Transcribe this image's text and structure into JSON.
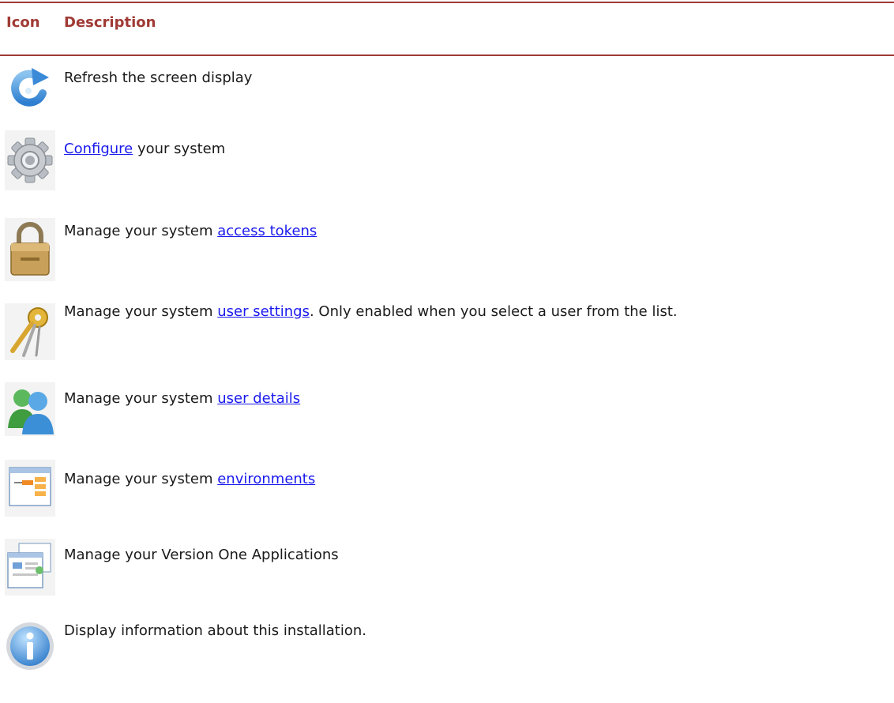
{
  "header": {
    "icon_label": "Icon",
    "description_label": "Description"
  },
  "rows": [
    {
      "icon": "refresh-icon",
      "before": "Refresh the screen display",
      "link": "",
      "after": ""
    },
    {
      "icon": "gear-icon",
      "before": "",
      "link": "Configure",
      "after": " your system"
    },
    {
      "icon": "lock-icon",
      "before": "Manage your system ",
      "link": "access tokens",
      "after": ""
    },
    {
      "icon": "keys-icon",
      "before": "Manage your system ",
      "link": "user settings",
      "after": ". Only enabled when you select a user from the list."
    },
    {
      "icon": "users-icon",
      "before": "Manage your system ",
      "link": "user details",
      "after": ""
    },
    {
      "icon": "environments-icon",
      "before": "Manage your system ",
      "link": "environments",
      "after": ""
    },
    {
      "icon": "applications-icon",
      "before": "Manage your Version One Applications",
      "link": "",
      "after": ""
    },
    {
      "icon": "info-icon",
      "before": "Display information about this installation.",
      "link": "",
      "after": ""
    }
  ],
  "colors": {
    "accent": "#a03a35",
    "link": "#1a1aee"
  }
}
